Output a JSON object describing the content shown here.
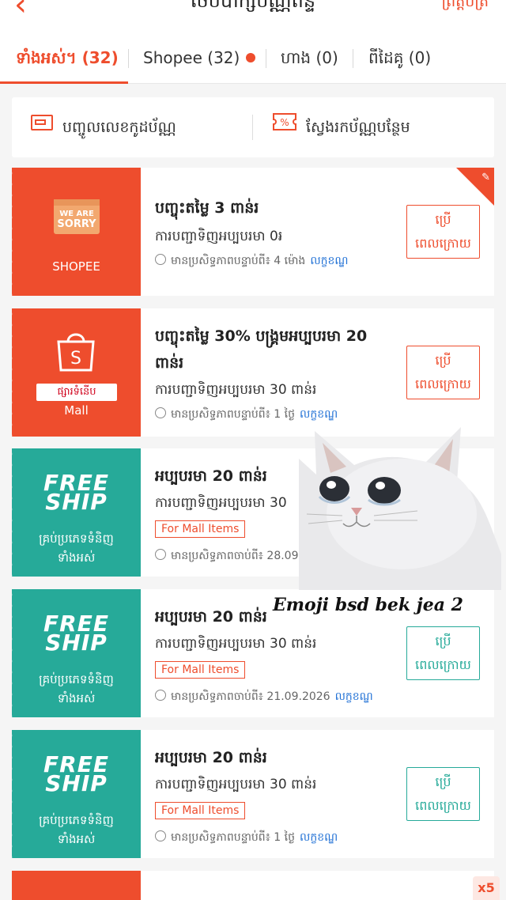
{
  "header": {
    "back_icon": "chevron-left-icon",
    "title": "ថេបបាក្សប័ណ្ណពិន្ទ",
    "right_link": "ព្រឹត្តិប័ត្រ"
  },
  "tabs": [
    {
      "label": "ទាំងអស់។ (32)",
      "active": true
    },
    {
      "label": "Shopee (32)",
      "has_dot": true
    },
    {
      "label": "ហាង (0)"
    },
    {
      "label": "ពីដៃគូ (0)"
    }
  ],
  "actions": {
    "enter_code": "បញ្ចូលលេខកូដប័ណ្ណ",
    "find_more": "ស្វែងរកប័ណ្ណបន្ថែម"
  },
  "vouchers": [
    {
      "left_brand": "SHOPEE",
      "left_image_text": "WE ARE SORRY",
      "title": "បញ្ចុះតម្លៃ 3 ពាន់រ",
      "condition": "ការបញ្ជាទិញអប្បបរមា 0៛",
      "validity": "មានប្រសិទ្ធភាពបន្ទាប់ពី៖ 4 ម៉ោង",
      "terms": "លក្ខខណ្ឌ",
      "button": [
        "ប្រើ",
        "ពេលក្រោយ"
      ],
      "color": "#ee4d2d"
    },
    {
      "left_brand": "Mall",
      "left_badge": "ផ្សារទំនើប",
      "title": "បញ្ចុះតម្លៃ 30% បង្គ្រមអប្បបរមា 20 ពាន់រ",
      "condition": "ការបញ្ជាទិញអប្បបរមា 30 ពាន់រ",
      "validity": "មានប្រសិទ្ធភាពបន្ទាប់ពី៖ 1 ថ្ងៃ",
      "terms": "លក្ខខណ្ឌ",
      "button": [
        "ប្រើ",
        "ពេលក្រោយ"
      ],
      "color": "#ee4d2d"
    },
    {
      "left_line1": "FREE",
      "left_line2": "SHIP",
      "left_sub": [
        "គ្រប់ប្រភេទទំនិញ",
        "ទាំងអស់"
      ],
      "title": "អប្បបរមា 20 ពាន់រ",
      "condition": "ការបញ្ជាទិញអប្បបរមា 30",
      "tag": "For Mall Items",
      "validity": "មានប្រសិទ្ធភាពចាប់ពី៖ 28.09.2",
      "color": "#26aa99"
    },
    {
      "left_line1": "FREE",
      "left_line2": "SHIP",
      "left_sub": [
        "គ្រប់ប្រភេទទំនិញ",
        "ទាំងអស់"
      ],
      "title": "អប្បបរមា 20 ពាន់រ",
      "condition": "ការបញ្ជាទិញអប្បបរមា 30 ពាន់រ",
      "tag": "For Mall Items",
      "validity": "មានប្រសិទ្ធភាពចាប់ពី៖ 21.09.2026",
      "terms": "លក្ខខណ្ឌ",
      "button": [
        "ប្រើ",
        "ពេលក្រោយ"
      ],
      "color": "#26aa99"
    },
    {
      "left_line1": "FREE",
      "left_line2": "SHIP",
      "left_sub": [
        "គ្រប់ប្រភេទទំនិញ",
        "ទាំងអស់"
      ],
      "title": "អប្បបរមា 20 ពាន់រ",
      "condition": "ការបញ្ជាទិញអប្បបរមា 30 ពាន់រ",
      "tag": "For Mall Items",
      "validity": "មានប្រសិទ្ធភាពបន្ទាប់ពី៖ 1 ថ្ងៃ",
      "terms": "លក្ខខណ្ឌ",
      "button": [
        "ប្រើ",
        "ពេលក្រោយ"
      ],
      "color": "#26aa99"
    }
  ],
  "overlay": {
    "caption": "Emoji bsd bek jea 2",
    "image": "crying-cat-meme"
  },
  "badge_x5": "x5",
  "colors": {
    "accent": "#ee4d2d",
    "teal": "#26aa99",
    "link": "#2473d6"
  }
}
